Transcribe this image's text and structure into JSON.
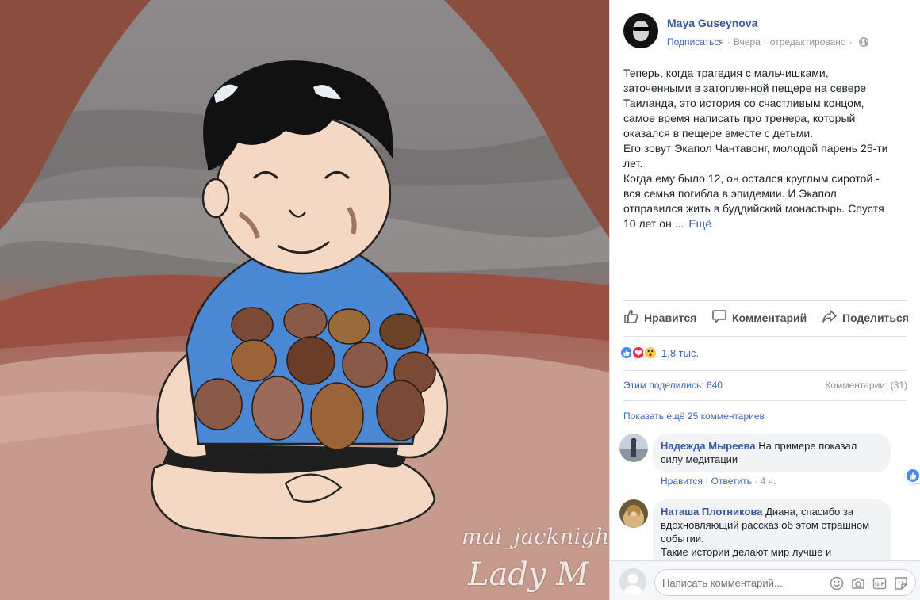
{
  "image": {
    "watermark_1": "mai_jacknight",
    "watermark_2": "Lady M",
    "signature": "маі"
  },
  "post": {
    "author": "Maya Guseynova",
    "follow": "Подписаться",
    "time": "Вчера",
    "edited": "отредактировано",
    "privacy_icon": "globe-icon",
    "text_lines": [
      "Теперь, когда трагедия с мальчишками,",
      "заточенными в затопленной пещере на севере",
      "Таиланда, это история со счастливым концом,",
      "самое время написать про тренера, который",
      "оказался в пещере вместе с детьми.",
      "Его зовут Экапол Чантавонг, молодой парень 25-ти",
      "лет.",
      "Когда ему было 12, он остался круглым сиротой -",
      "вся семья погибла в эпидемии. И Экапол",
      "отправился жить в буддийский монастырь. Спустя",
      "10 лет он ..."
    ],
    "more": "Ещё"
  },
  "actions": {
    "like": "Нравится",
    "comment": "Комментарий",
    "share": "Поделиться"
  },
  "reactions": {
    "icons": [
      "like-icon",
      "love-icon",
      "wow-icon"
    ],
    "count": "1,8 тыс."
  },
  "stats": {
    "shares": "Этим поделились: 640",
    "comments": "Комментарии: (31)"
  },
  "show_more_comments": "Показать ещё 25 комментариев",
  "comments": [
    {
      "name": "Надежда Мыреева",
      "text": "На примере показал силу медитации",
      "like": "Нравится",
      "reply": "Ответить",
      "time": "4 ч.",
      "reaction_count": "1"
    },
    {
      "name": "Наташа Плотникова",
      "text": "Диана, спасибо за вдохновляющий рассказ об этом страшном событии.",
      "text_2": "Такие истории делают мир лучше и"
    }
  ],
  "compose": {
    "placeholder": "Написать комментарий...",
    "icons": [
      "emoji-icon",
      "camera-icon",
      "gif-icon",
      "sticker-icon"
    ]
  },
  "colors": {
    "link": "#385898",
    "accent": "#4267b2",
    "muted": "#90949c",
    "shirt": "#4a88d3"
  }
}
